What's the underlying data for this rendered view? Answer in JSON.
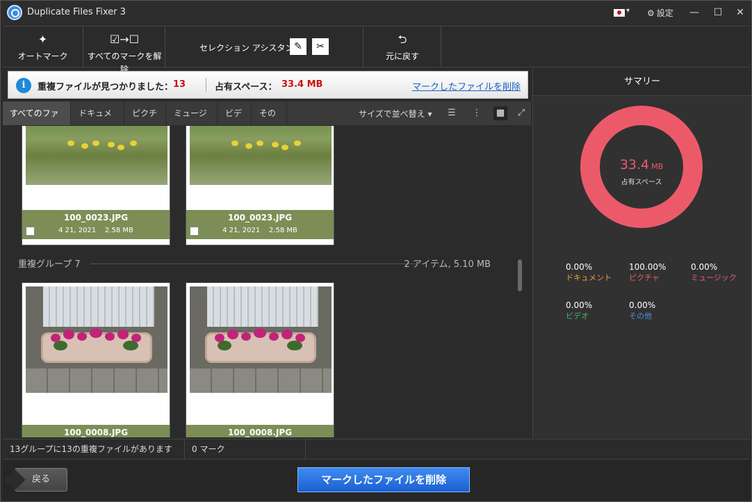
{
  "window": {
    "title": "Duplicate Files Fixer 3",
    "settings_label": "設定",
    "minimize": "—",
    "maximize": "☐",
    "close": "✕"
  },
  "toolbar": {
    "auto_mark": "オートマーク",
    "unmark_all": "すべてのマークを解除",
    "selection_assistant": "セレクション アシスタント",
    "undo": "元に戻す"
  },
  "infobar": {
    "duplicates_label": "重複ファイルが見つかりました：",
    "duplicates_count": "13",
    "space_label": "占有スペース：",
    "space_value": "33.4 MB",
    "delete_link": "マークしたファイルを削除"
  },
  "tabs": [
    {
      "label": "すべてのファイル"
    },
    {
      "label": "ドキュメント"
    },
    {
      "label": "ピクチャ"
    },
    {
      "label": "ミュージック"
    },
    {
      "label": "ビデオ"
    },
    {
      "label": "その他"
    }
  ],
  "sort_label": "サイズで並べ替え",
  "groups": [
    {
      "items": [
        {
          "name": "100_0023.JPG",
          "date": "4 21, 2021",
          "size": "2.58 MB"
        },
        {
          "name": "100_0023.JPG",
          "date": "4 21, 2021",
          "size": "2.58 MB"
        }
      ]
    },
    {
      "name": "重複グループ 7",
      "info": "2 アイテム, 5.10 MB",
      "items": [
        {
          "name": "100_0008.JPG"
        },
        {
          "name": "100_0008.JPG"
        }
      ]
    }
  ],
  "summary": {
    "title": "サマリー",
    "total_value": "33.4",
    "total_unit": "MB",
    "total_label": "占有スペース",
    "ring_color": "#ec5a6a",
    "stats": [
      {
        "pct": "0.00%",
        "name": "ドキュメント",
        "color": "#e8a33a"
      },
      {
        "pct": "100.00%",
        "name": "ピクチャ",
        "color": "#ec5a6a"
      },
      {
        "pct": "0.00%",
        "name": "ミュージック",
        "color": "#e05aa0"
      },
      {
        "pct": "0.00%",
        "name": "ビデオ",
        "color": "#3fb46a"
      },
      {
        "pct": "0.00%",
        "name": "その他",
        "color": "#4a90d9"
      }
    ]
  },
  "statusbar": {
    "groups_text": "13グループに13の重複ファイルがあります",
    "marked_text": "0 マーク"
  },
  "bottom": {
    "back": "戻る",
    "delete": "マークしたファイルを削除"
  }
}
